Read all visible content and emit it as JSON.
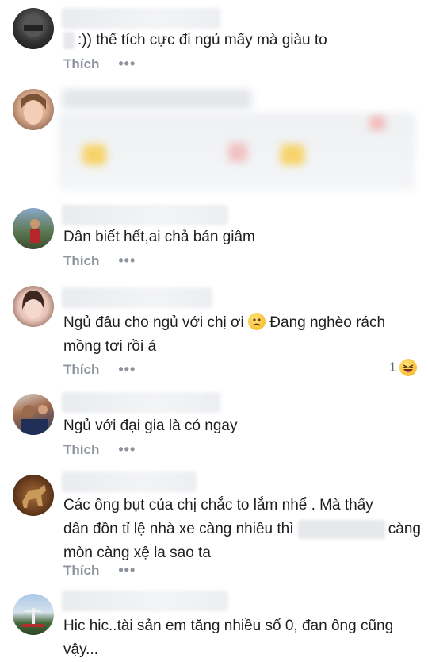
{
  "comments": [
    {
      "text": ":)) thế tích cực đi ngủ mấy mà giàu to",
      "like_label": "Thích",
      "more_label": "•••"
    },
    {
      "text": "",
      "like_label": "",
      "more_label": ""
    },
    {
      "text": "Dân biết hết,ai chả bán giâm",
      "like_label": "Thích",
      "more_label": "•••"
    },
    {
      "text_part1": "Ngủ đâu cho ngủ với chị ơi ",
      "text_part2": " Đang nghèo rách\nmồng tơi rồi á",
      "like_label": "Thích",
      "more_label": "•••",
      "reaction_count": "1",
      "inline_emoji": "worried-face-emoji",
      "reaction_emoji": "laughing-face-emoji"
    },
    {
      "text": "Ngủ với đại gia là có ngay",
      "like_label": "Thích",
      "more_label": "•••"
    },
    {
      "text_part1": "Các ông bụt của chị chắc to lắm nhể . Mà thấy\ndân đồn tỉ lệ nhà xe càng nhiều thì ",
      "text_part2": "càng\nmòn càng xệ la sao ta",
      "like_label": "Thích",
      "more_label": "•••"
    },
    {
      "text": "Hic hic..tài sản em tăng nhiều số 0, đan ông cũng\nvậy...",
      "like_label": "",
      "more_label": ""
    }
  ],
  "colors": {
    "meta_gray": "#8d949e",
    "text": "#1c1e21",
    "emoji_yellow": "#f7b21b"
  }
}
